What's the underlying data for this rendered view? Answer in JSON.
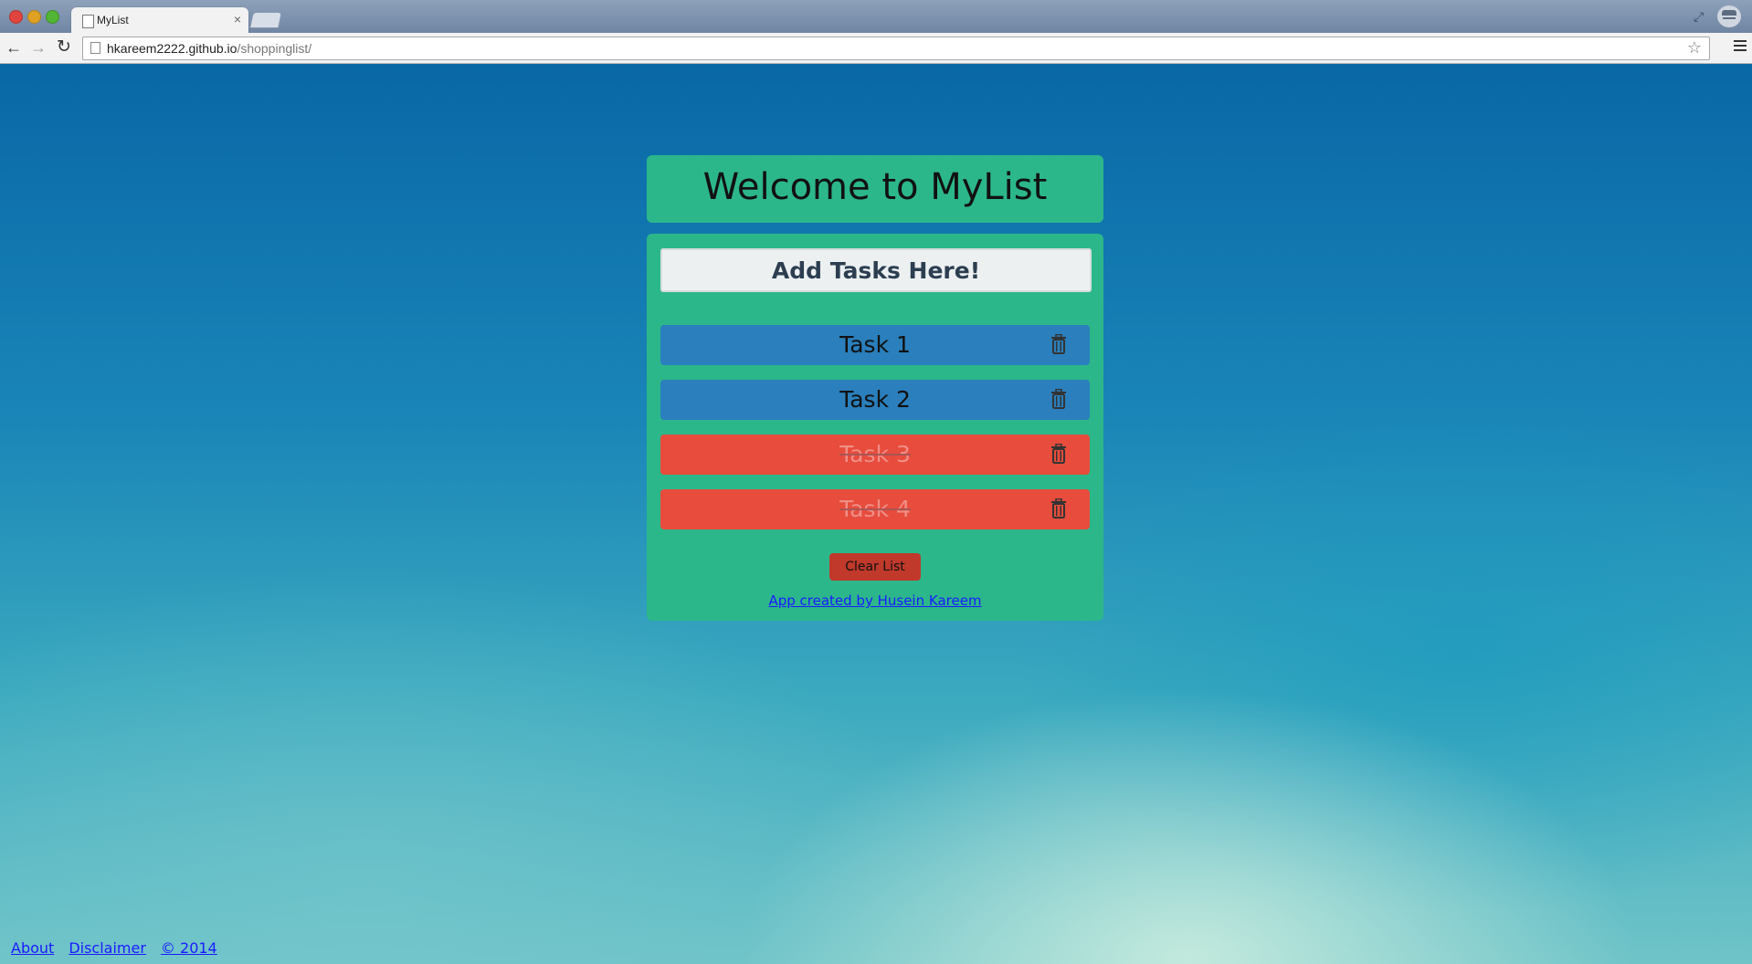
{
  "browser": {
    "tab_title": "MyList",
    "tab_close": "×",
    "url_host": "hkareem2222.github.io",
    "url_path": "/shoppinglist/",
    "back": "←",
    "forward": "→",
    "reload": "↻",
    "star": "☆",
    "fullscreen": "⤢"
  },
  "header": {
    "title": "Welcome to MyList"
  },
  "input": {
    "placeholder": "Add Tasks Here!"
  },
  "tasks": [
    {
      "label": "Task 1",
      "done": false
    },
    {
      "label": "Task 2",
      "done": false
    },
    {
      "label": "Task 3",
      "done": true
    },
    {
      "label": "Task 4",
      "done": true
    }
  ],
  "clear_label": "Clear List",
  "credit": "App created by Husein Kareem",
  "footer": {
    "about": "About",
    "disclaimer": "Disclaimer",
    "copyright": "© 2014"
  },
  "colors": {
    "card": "#2cb78a",
    "task_active": "#2a7fbc",
    "task_done": "#e74c3c",
    "clear_button": "#c0392b"
  }
}
